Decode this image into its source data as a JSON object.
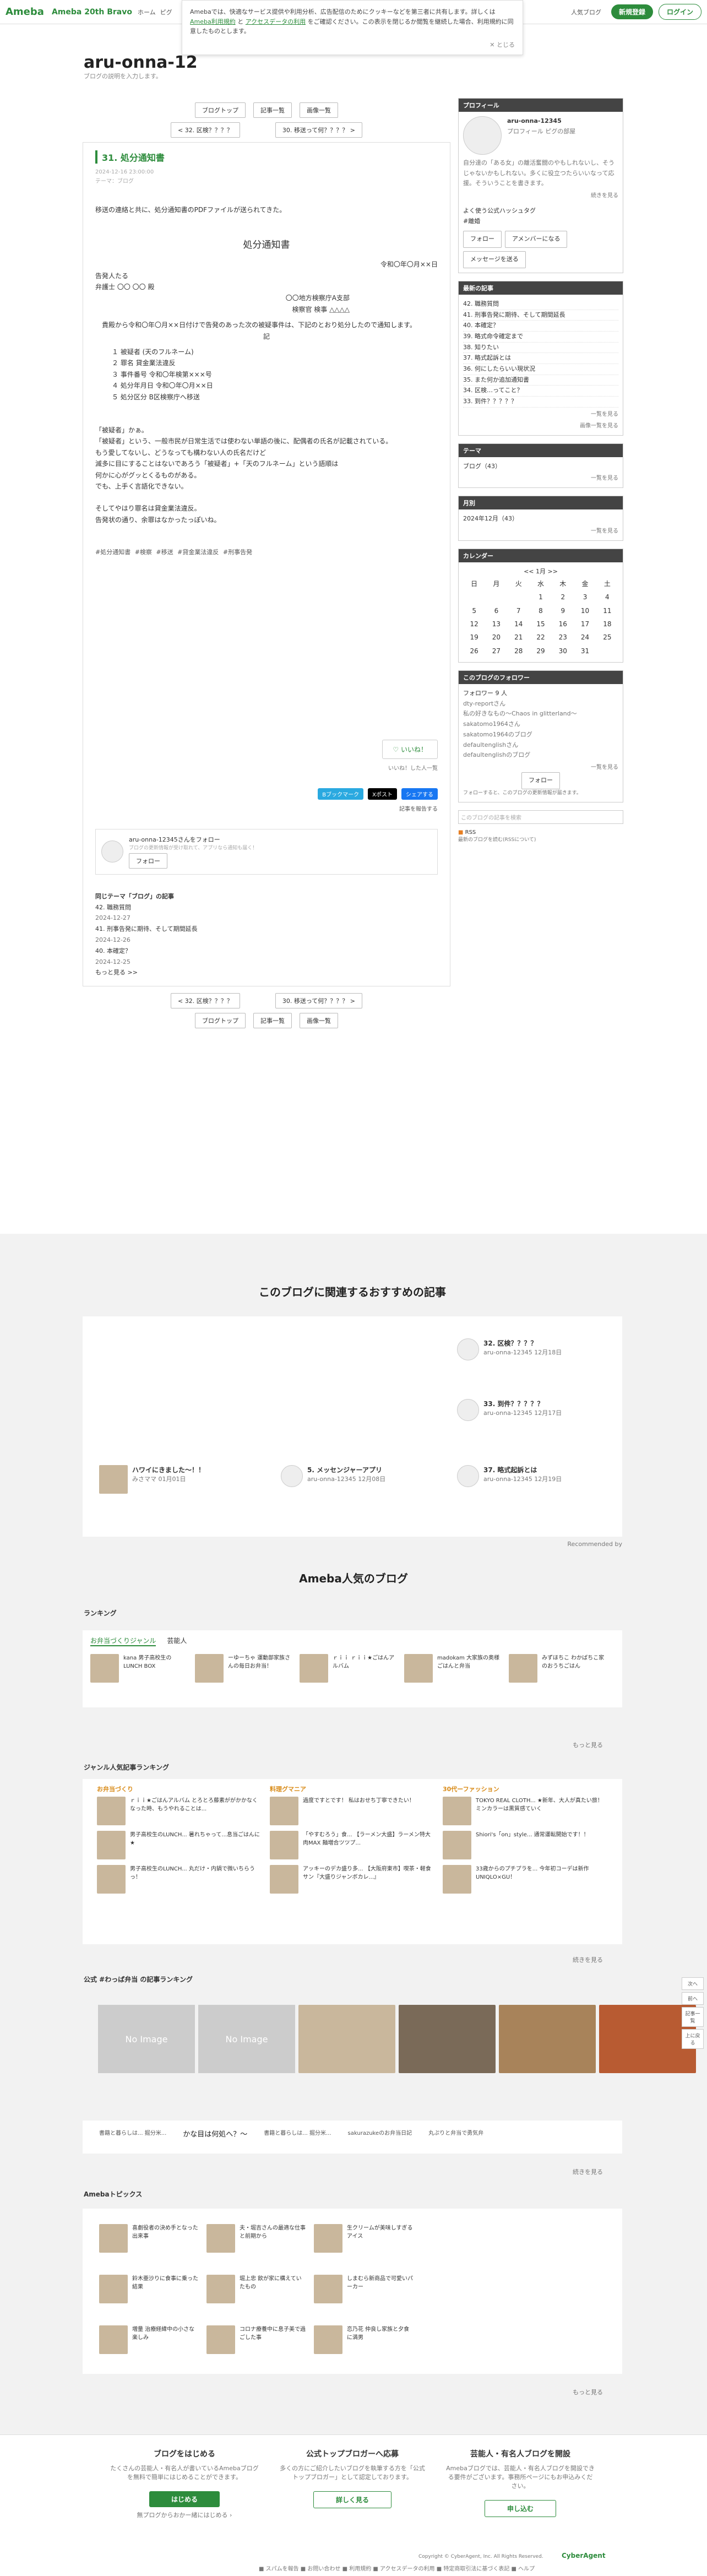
{
  "header": {
    "logo": "Ameba",
    "logo2": "Ameba 20th Bravo",
    "nav": [
      "ホーム",
      "ピグ",
      "AmebaBlog"
    ],
    "top_blogger": "人気ブログ",
    "signup": "新規登録",
    "login": "ログイン"
  },
  "cookie": {
    "text": "Amebaでは、快適なサービス提供や利用分析、広告配信のためにクッキーなどを第三者に共有します。詳しくは",
    "link1": "Ameba利用規約",
    "mid": "と",
    "link2": "アクセスデータの利用",
    "tail": "をご確認ください。この表示を閉じるか閲覧を継続した場合、利用規約に同意したものとします。",
    "close": "✕ とじる"
  },
  "blog": {
    "title": "aru-onna-12",
    "desc": "ブログの説明を入力します。"
  },
  "buttons": {
    "blog_top": "ブログトップ",
    "articles": "記事一覧",
    "images": "画像一覧",
    "prev": "< 32. 区検？？？？",
    "next": "30. 移送って何？？？？ >"
  },
  "article": {
    "title": "31. 処分通知書",
    "date": "2024-12-16 23:00:00",
    "theme": "テーマ：ブログ",
    "intro": "移送の連絡と共に、処分通知書のPDFファイルが送られてきた。",
    "notice_title": "処分通知書",
    "notice_date": "令和〇年〇月××日",
    "to1": "告発人たる",
    "to2": "弁護士 〇〇 〇〇 殿",
    "from1": "〇〇地方検察庁A支部",
    "from2": "検察官 検事 △△△△",
    "body1": "貴殿から令和〇年〇月××日付けで告発のあった次の被疑事件は、下記のとおり処分したので通知します。",
    "ki": "記",
    "lines": [
      "１ 被疑者 (天のフルネーム)",
      "２ 罪名 貸金業法違反",
      "３ 事件番号 令和〇年検第×××号",
      "４ 処分年月日 令和〇年〇月××日",
      "５ 処分区分 B区検察庁へ移送"
    ],
    "body2": [
      "「被疑者」かぁ。",
      "「被疑者」という、一般市民が日常生活では使わない単語の後に、配偶者の氏名が記載されている。",
      "もう愛してないし、どうなっても構わない人の氏名だけど",
      "減多に目にすることはないであろう「被疑者」+「天のフルネーム」という語順は",
      "何かに心がグッとくるものがある。",
      "でも、上手く言語化できない。",
      "",
      "そしてやはり罪名は貸金業法違反。",
      "告発状の通り、余罪はなかったっぽいね。"
    ],
    "tags": "#処分通知書 #検察 #移送 #貸金業法違反 #刑事告発",
    "like": "いいね！",
    "like_users": "いいね！した人一覧",
    "report": "記事を報告する",
    "share_b": "Bブックマーク",
    "share_x": "Xポスト",
    "share_f": "シェアする",
    "follow_text": "aru-onna-12345さんをフォロー",
    "follow_sub": "ブログの更新情報が受け取れて、アプリなら通知も届く！",
    "follow_btn": "フォロー",
    "related_title": "同じテーマ「ブログ」の記事",
    "related": [
      "42. 職務質問",
      "2024-12-27",
      "41. 刑事告発に期待、そして期間延長",
      "2024-12-26",
      "40. 本確定？",
      "2024-12-25",
      "もっと見る >>"
    ]
  },
  "profile": {
    "head": "プロフィール",
    "name": "aru-onna-12345",
    "links": "プロフィール ピグの部屋",
    "bio": "自分達の「ある女」の離活奮闘のやもしれないし、そうじゃないかもしれない。多くに役立つたらいいなって応援。そういうことを書きます。",
    "more": "続きを見る",
    "hashtag": "よく使う公式ハッシュタグ",
    "tag": "#離婚",
    "follow": "フォロー",
    "amember": "アメンバーになる",
    "message": "メッセージを送る"
  },
  "recent": {
    "head": "最新の記事",
    "items": [
      "42. 職務質問",
      "41. 刑事告発に期待、そして期間延長",
      "40. 本確定？",
      "39. 略式命令確定まで",
      "38. 知りたい",
      "37. 略式起訴とは",
      "36. 何にしたらいい現状況",
      "35. また何か追加通知書",
      "34. 区検…ってこと？",
      "33. 到件？？？？？"
    ],
    "more": "一覧を見る",
    "images": "画像一覧を見る"
  },
  "theme": {
    "head": "テーマ",
    "item": "ブログ（43）",
    "more": "一覧を見る"
  },
  "monthly": {
    "head": "月別",
    "item": "2024年12月（43）",
    "more": "一覧を見る"
  },
  "calendar": {
    "head": "カレンダー",
    "month": "<<   1月   >>",
    "dow": [
      "日",
      "月",
      "火",
      "水",
      "木",
      "金",
      "土"
    ],
    "rows": [
      [
        "",
        "",
        "",
        "1",
        "2",
        "3",
        "4"
      ],
      [
        "5",
        "6",
        "7",
        "8",
        "9",
        "10",
        "11"
      ],
      [
        "12",
        "13",
        "14",
        "15",
        "16",
        "17",
        "18"
      ],
      [
        "19",
        "20",
        "21",
        "22",
        "23",
        "24",
        "25"
      ],
      [
        "26",
        "27",
        "28",
        "29",
        "30",
        "31",
        ""
      ]
    ]
  },
  "followers": {
    "head": "このブログのフォロワー",
    "count": "フォロワー 9 人",
    "list": [
      "dty-reportさん",
      "私の好きなもの〜Chaos in glitterland〜",
      "sakatomo1964さん",
      "sakatomo1964のブログ",
      "defaultenglishさん",
      "defaultenglishのブログ"
    ],
    "more": "一覧を見る",
    "follow": "フォロー",
    "note": "フォローすると、このブログの更新情報が届きます。"
  },
  "rss": {
    "search": "このブログの記事を検索",
    "rss": "RSS",
    "rss_note": "最新のブログを読む(RSSについて)"
  },
  "recommend": {
    "title": "このブログに関連するおすすめの記事",
    "items": [
      {
        "t": "32. 区検？？？？",
        "by": "aru-onna-12345",
        "d": "12月18日"
      },
      {
        "t": "33. 到件？？？？？",
        "by": "aru-onna-12345",
        "d": "12月17日"
      },
      {
        "t": "ハワイにきました〜！！",
        "by": "みさママ",
        "d": "01月01日"
      },
      {
        "t": "5. メッセンジャーアプリ",
        "by": "aru-onna-12345",
        "d": "12月08日"
      },
      {
        "t": "37. 略式起訴とは",
        "by": "aru-onna-12345",
        "d": "12月19日"
      }
    ],
    "powered": "Recommended by"
  },
  "popular": {
    "title": "Ameba人気のブログ",
    "ranking": "ランキング",
    "tabs": [
      "お弁当づくりジャンル",
      "芸能人"
    ],
    "rank_items": [
      "kana 男子高校生のLUNCH BOX",
      "ーゆーちゃ 運動部家族さんの毎日お弁当！",
      "ｒｉｉ ｒｉｉ★ごはんアルバム",
      "madokam 大家族の奥様ごはんと弁当",
      "みずほちこ わかばちこ家のおうちごはん"
    ],
    "more": "もっと見る",
    "genre_title": "ジャンル人気記事ランキング",
    "genres": [
      {
        "h": "お弁当づくり",
        "items": [
          "ｒｉｉ★ごはんアルバム とろとろ藤素ががかかなくなった時、もうやれることは...",
          "男子高校生のLUNCH... 暑れちゃって...息当ごはんに★",
          "男子高校生のLUNCH... 丸だけ・内鍋で微いちらうっ！"
        ]
      },
      {
        "h": "料理グマニア",
        "items": [
          "過度ですとです！ 私はおせち丁寧できたい！",
          "「やすむろう」食... 【ラーメン大盛】ラーメン特大肉MAX 麺増合ツツプ...",
          "アッキーのデカ盛り多... 【大阪府東市】喫茶・軽食 サン『大盛りジャンボカレ...』"
        ]
      },
      {
        "h": "30代ーファッション",
        "items": [
          "TOKYO REAL CLOTH... ★新年、大人が真たい旅！ ミンカラーは黒質感ていく",
          "Shiori's「on」style... 通常運転開始です！！",
          "33歳からのプチプラを... 今年初コーデは新作UNIQLO×GU！"
        ]
      }
    ],
    "more2": "続きを見る",
    "bento_title": "公式 #わっぱ弁当 の記事ランキング",
    "no_image": "No Image",
    "bento_more": "続きを見る",
    "tail_items": [
      "書籍と暮らしは... 掘分米...",
      "かな目は何処へ？〜",
      "書籍と暮らしは... 掘分米...",
      "sakurazukeのお弁当日記",
      "丸ぷりと弁当で勇気弁"
    ],
    "tail_more": "もっと見る"
  },
  "topics": {
    "title": "Amebaトピックス",
    "items": [
      "喜劇役者の決め手となった出来事",
      "夫・堀吉さんの最適な仕事と前期から",
      "生クリームが美味しすぎるアイス",
      "鈴木亜沙りに食事に乗った結果",
      "堀上忠 飲が家に構えていたもの",
      "しまむら新商品で可愛いパーカー",
      "増量 治療経緯中の小さな楽しみ",
      "コロナ療養中に息子美で過ごした事",
      "恋乃花 仲良し家族と夕食に満男"
    ],
    "more": "もっと見る"
  },
  "footer": {
    "c1_title": "ブログをはじめる",
    "c1_text": "たくさんの芸能人・有名人が書いているAmebaブログを無料で簡単にはじめることができます。",
    "c1_btn": "はじめる",
    "c1_link": "無プログからおかー緒にはじめる ›",
    "c2_title": "公式トップブロガーへ応募",
    "c2_text": "多くの方にご紹介したいブログを執筆する方を「公式トップブロガー」として認定しております。",
    "c2_btn": "詳しく見る",
    "c3_title": "芸能人・有名人ブログを開設",
    "c3_text": "Amebaブログでは、芸能人・有名人ブログを開設できる要件がございます。事務所ページにもお申込みください。",
    "c3_btn": "申し込む",
    "copyright": "Copyright © CyberAgent, Inc. All Rights Reserved.",
    "links": "■ スパムを報告 ■ お問い合わせ ■ 利用規約 ■ アクセスデータの利用 ■ 特定商取引法に基づく表記 ■ ヘルプ",
    "ca": "CyberAgent"
  },
  "rightnav": {
    "next": "次へ",
    "prev": "前へ",
    "list": "記事一覧",
    "top": "上に戻る"
  }
}
